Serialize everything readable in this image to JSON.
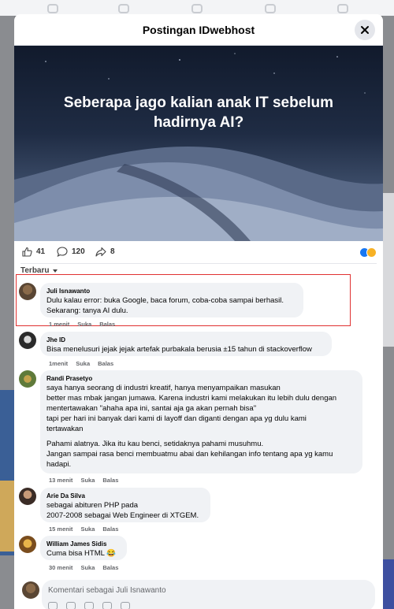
{
  "modal": {
    "title": "Postingan IDwebhost",
    "post_caption": "Seberapa jago kalian anak IT sebelum hadirnya AI?"
  },
  "stats": {
    "likes": "41",
    "comments": "120",
    "shares": "8"
  },
  "sort": {
    "label": "Terbaru"
  },
  "comments": [
    {
      "author": "Juli Isnawanto",
      "text": "Dulu kalau error: buka Google, baca forum, coba-coba sampai berhasil.\nSekarang: tanya AI dulu.",
      "time": "1 menit",
      "like": "Suka",
      "reply": "Balas"
    },
    {
      "author": "Jhe ID",
      "text": "Bisa menelusuri jejak jejak artefak purbakala berusia ±15 tahun di stackoverflow",
      "time": "1menit",
      "like": "Suka",
      "reply": "Balas"
    },
    {
      "author": "Randi Prasetyo",
      "text": "saya hanya seorang di industri kreatif, hanya menyampaikan masukan\nbetter mas mbak jangan jumawa. Karena industri kami melakukan itu lebih dulu dengan\nmentertawakan \"ahaha apa ini, santai aja ga akan pernah bisa\"\ntapi per hari ini banyak dari kami di layoff dan diganti dengan apa yg dulu kami\ntertawakan",
      "text2": "Pahami alatnya. Jika itu kau benci, setidaknya pahami musuhmu.\nJangan sampai rasa benci membuatmu abai dan kehilangan info tentang apa yg kamu\nhadapi.",
      "time": "13 menit",
      "like": "Suka",
      "reply": "Balas"
    },
    {
      "author": "Arie Da Silva",
      "text": "sebagai abituren PHP pada\n2007-2008 sebagai Web Engineer di XTGEM.",
      "time": "15 menit",
      "like": "Suka",
      "reply": "Balas"
    },
    {
      "author": "William James Sidis",
      "text": "Cuma bisa HTML 😂",
      "time": "30 menit",
      "like": "Suka",
      "reply": "Balas"
    }
  ],
  "composer": {
    "placeholder": "Komentari sebagai Juli Isnawanto"
  },
  "colors": {
    "brand_blue": "#1877f2",
    "highlight": "#e03131",
    "bubble": "#f0f2f5"
  }
}
